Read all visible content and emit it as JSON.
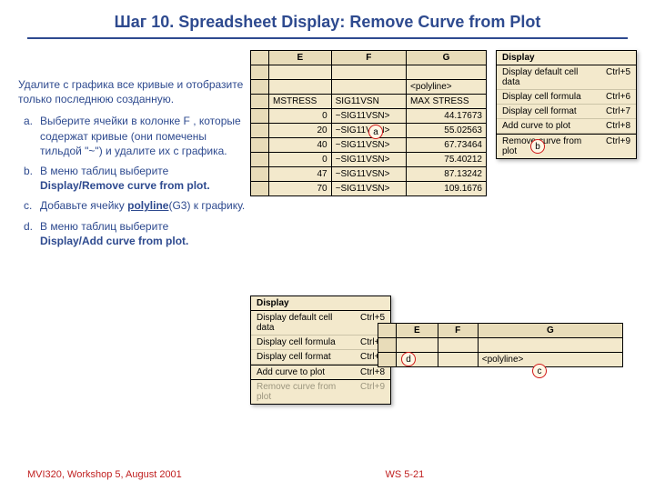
{
  "title": "Шаг 10.  Spreadsheet Display:  Remove Curve from Plot",
  "paragraph": "Удалите с графика все кривые и отобразите только последнюю созданную.",
  "steps": {
    "a": "Выберите ячейки в колонке F , которые содержат кривые (они помечены тильдой  \"~\") и удалите их с графика.",
    "b1": "В меню таблиц выберите",
    "b2": "Display/Remove curve from plot.",
    "c1": "Добавьте ячейку ",
    "c2": "polyline",
    "c3": "(G3) к графику.",
    "d1": " В меню таблиц выберите",
    "d2": "Display/Add curve from plot."
  },
  "sheetTop": {
    "cols": [
      "E",
      "F",
      "G"
    ],
    "row_meta": "<polyline>",
    "row_hdr": [
      "MSTRESS",
      "SIG11VSN",
      "MAX STRESS"
    ],
    "rows": [
      {
        "e": "0",
        "f": "~SIG11VSN>",
        "g": "44.17673"
      },
      {
        "e": "20",
        "f": "~SIG11VSN>",
        "g": "55.02563"
      },
      {
        "e": "40",
        "f": "~SIG11VSN>",
        "g": "67.73464"
      },
      {
        "e": "0",
        "f": "~SIG11VSN>",
        "g": "75.40212"
      },
      {
        "e": "47",
        "f": "~SIG11VSN>",
        "g": "87.13242"
      },
      {
        "e": "70",
        "f": "~SIG11VSN>",
        "g": "109.1676"
      }
    ]
  },
  "menuTop": {
    "head": "Display",
    "items": [
      {
        "label": "Display default cell data",
        "sc": "Ctrl+5"
      },
      {
        "label": "Display cell formula",
        "sc": "Ctrl+6"
      },
      {
        "label": "Display cell format",
        "sc": "Ctrl+7"
      },
      {
        "label": "Add curve to plot",
        "sc": "Ctrl+8"
      },
      {
        "label": "Remove curve from plot",
        "sc": "Ctrl+9",
        "hilite": true
      }
    ]
  },
  "menuBottom": {
    "head": "Display",
    "items": [
      {
        "label": "Display default cell data",
        "sc": "Ctrl+5"
      },
      {
        "label": "Display cell formula",
        "sc": "Ctrl+6"
      },
      {
        "label": "Display cell format",
        "sc": "Ctrl+7"
      },
      {
        "label": "Add curve to plot",
        "sc": "Ctrl+8",
        "hilite": true
      },
      {
        "label": "Remove curve from plot",
        "sc": "Ctrl+9",
        "disabled": true
      }
    ]
  },
  "sheetBottom": {
    "cols": [
      "E",
      "F",
      "G"
    ],
    "row_meta": "<polyline>"
  },
  "callouts": {
    "a": "a",
    "b": "b",
    "c": "c",
    "d": "d"
  },
  "footer": {
    "left": "MVI320, Workshop 5, August 2001",
    "right": "WS 5-21"
  }
}
